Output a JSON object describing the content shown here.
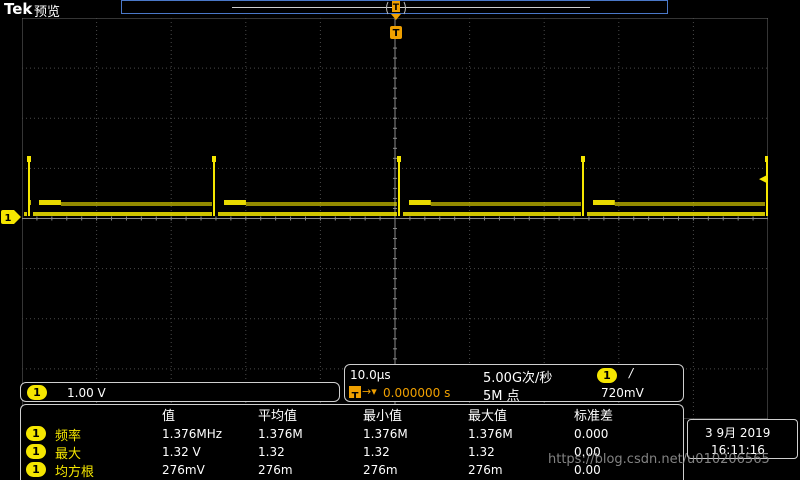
{
  "header": {
    "brand": "Tek",
    "mode": "预览"
  },
  "trigger": {
    "marker": "T",
    "position_marker": "T",
    "level_arrow": "◀"
  },
  "channel": {
    "number": "1",
    "scale": "1.00 V",
    "color": "#f5e600"
  },
  "timebase": {
    "horizontal": "10.0μs",
    "sample_rate": "5.00G次/秒",
    "trigger_offset": "0.000000 s",
    "record_length": "5M 点",
    "trigger_channel": "1",
    "trigger_slope": "/",
    "trigger_level": "720mV"
  },
  "measurements": {
    "headers": [
      "值",
      "平均值",
      "最小值",
      "最大值",
      "标准差"
    ],
    "rows": [
      {
        "channel": "1",
        "name": "频率",
        "values": [
          "1.376MHz",
          "1.376M",
          "1.376M",
          "1.376M",
          "0.000"
        ]
      },
      {
        "channel": "1",
        "name": "最大",
        "values": [
          "1.32 V",
          "1.32",
          "1.32",
          "1.32",
          "0.00"
        ]
      },
      {
        "channel": "1",
        "name": "均方根",
        "values": [
          "276mV",
          "276m",
          "276m",
          "276m",
          "0.00"
        ]
      }
    ]
  },
  "datetime": {
    "date": "3 9月 2019",
    "time": "16:11:16"
  },
  "watermark": "https://blog.csdn.net/u010206565"
}
